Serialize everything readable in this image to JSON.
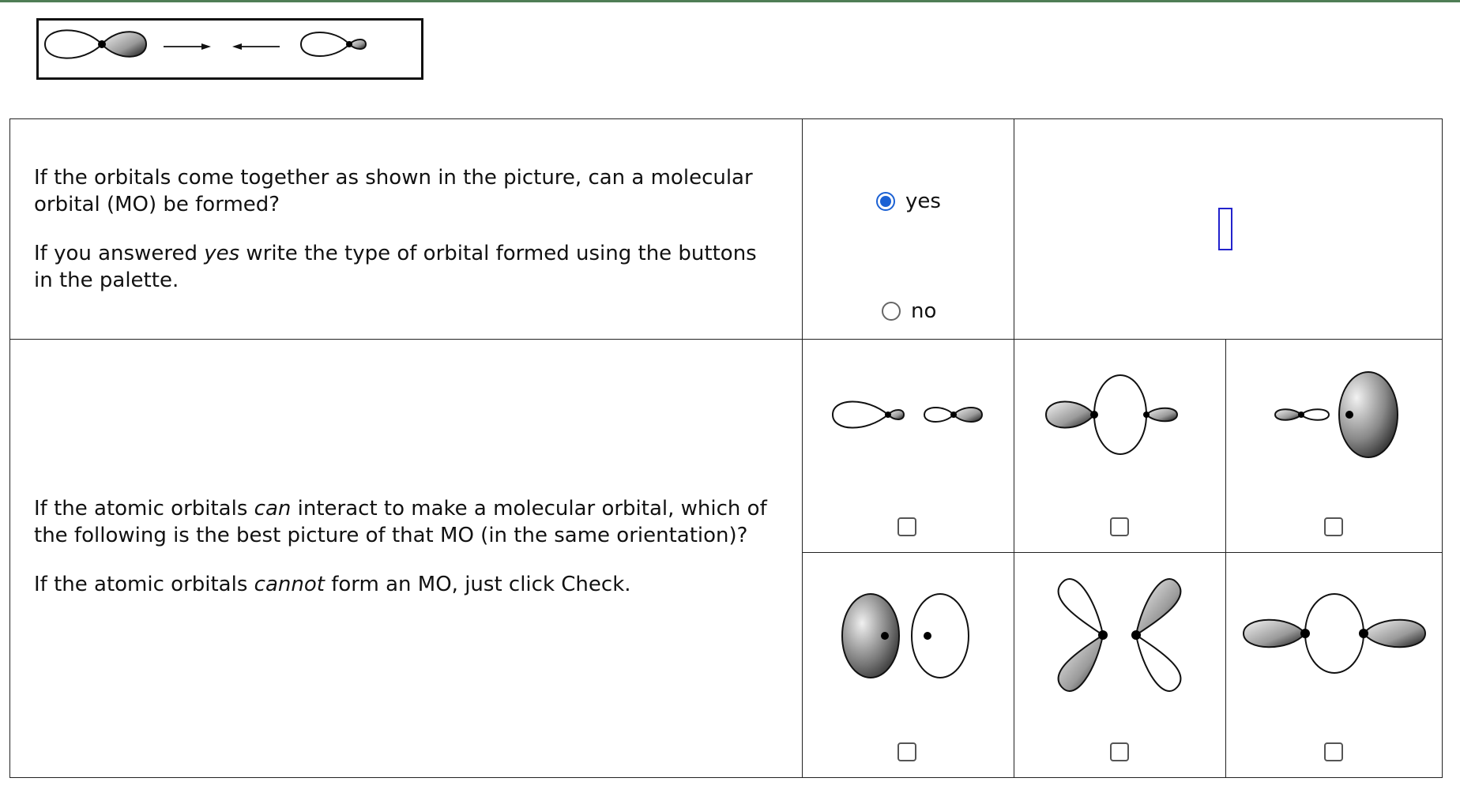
{
  "colors": {
    "top_bar": "#4f7d55",
    "radio_selected": "#1b61d4",
    "answer_box_border": "#2222cc"
  },
  "question1": {
    "prompt_line1": "If the orbitals come together as shown in the picture, can a molecular orbital (MO) be formed?",
    "prompt_pre": "If you answered ",
    "prompt_em": "yes",
    "prompt_post": " write the type of orbital formed using the buttons in the palette.",
    "options": [
      {
        "label": "yes",
        "selected": true
      },
      {
        "label": "no",
        "selected": false
      }
    ],
    "answer_value": ""
  },
  "question2": {
    "p1_pre": "If the atomic orbitals ",
    "p1_em": "can",
    "p1_post": " interact to make a molecular orbital, which of the following is the best picture of that MO (in the same orientation)?",
    "p2_pre": "If the atomic orbitals ",
    "p2_em": "cannot",
    "p2_post": " form an MO, just click Check.",
    "choices": [
      {
        "icon": "sp-hybrid-antibonding-pair-icon",
        "checked": false
      },
      {
        "icon": "p-s-p-sigma-icon",
        "checked": false
      },
      {
        "icon": "sp-p-pi-icon",
        "checked": false
      },
      {
        "icon": "p-p-side-by-side-icon",
        "checked": false
      },
      {
        "icon": "d-orbital-cloverleaf-icon",
        "checked": false
      },
      {
        "icon": "p-s-p-sigma-bonding-icon",
        "checked": false
      }
    ]
  }
}
